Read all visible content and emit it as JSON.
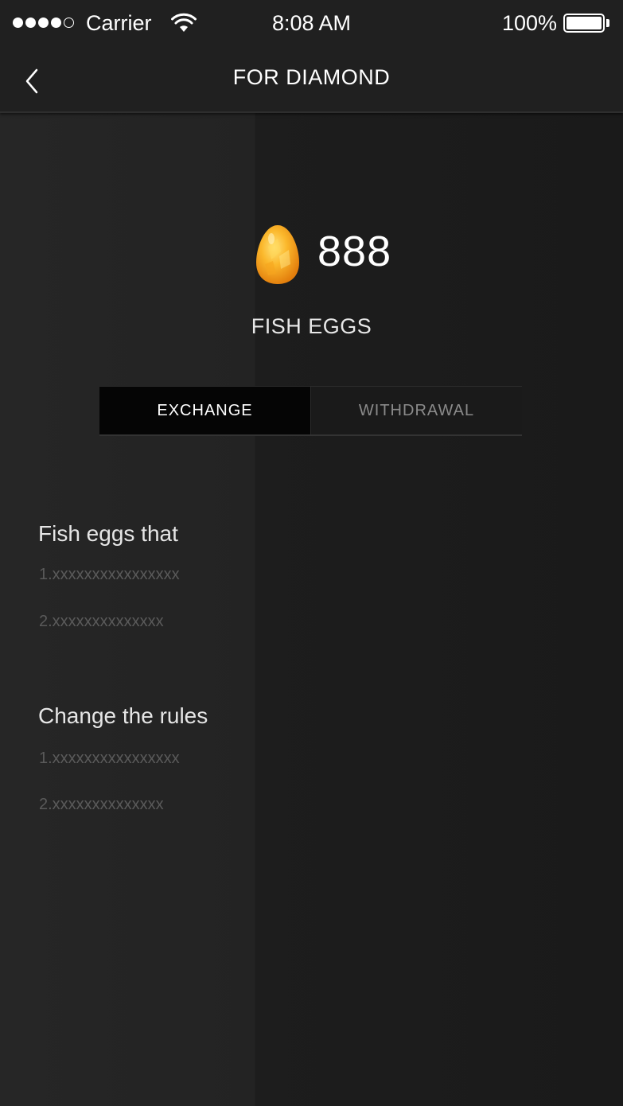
{
  "status_bar": {
    "carrier": "Carrier",
    "time": "8:08 AM",
    "battery": "100%"
  },
  "nav": {
    "title": "FOR DIAMOND"
  },
  "balance": {
    "amount": "888",
    "currency": "FISH EGGS",
    "icon": "egg-icon"
  },
  "tabs": [
    {
      "label": "EXCHANGE",
      "active": true
    },
    {
      "label": "WITHDRAWAL",
      "active": false
    }
  ],
  "sections": [
    {
      "title": "Fish eggs that",
      "items": [
        "1.xxxxxxxxxxxxxxxx",
        "2.xxxxxxxxxxxxxx"
      ]
    },
    {
      "title": "Change the rules",
      "items": [
        "1.xxxxxxxxxxxxxxxx",
        "2.xxxxxxxxxxxxxx"
      ]
    }
  ],
  "colors": {
    "background": "#1c1c1e",
    "active_tab": "#050505",
    "muted_text": "#5a5a5a",
    "egg": "#f5a623"
  }
}
